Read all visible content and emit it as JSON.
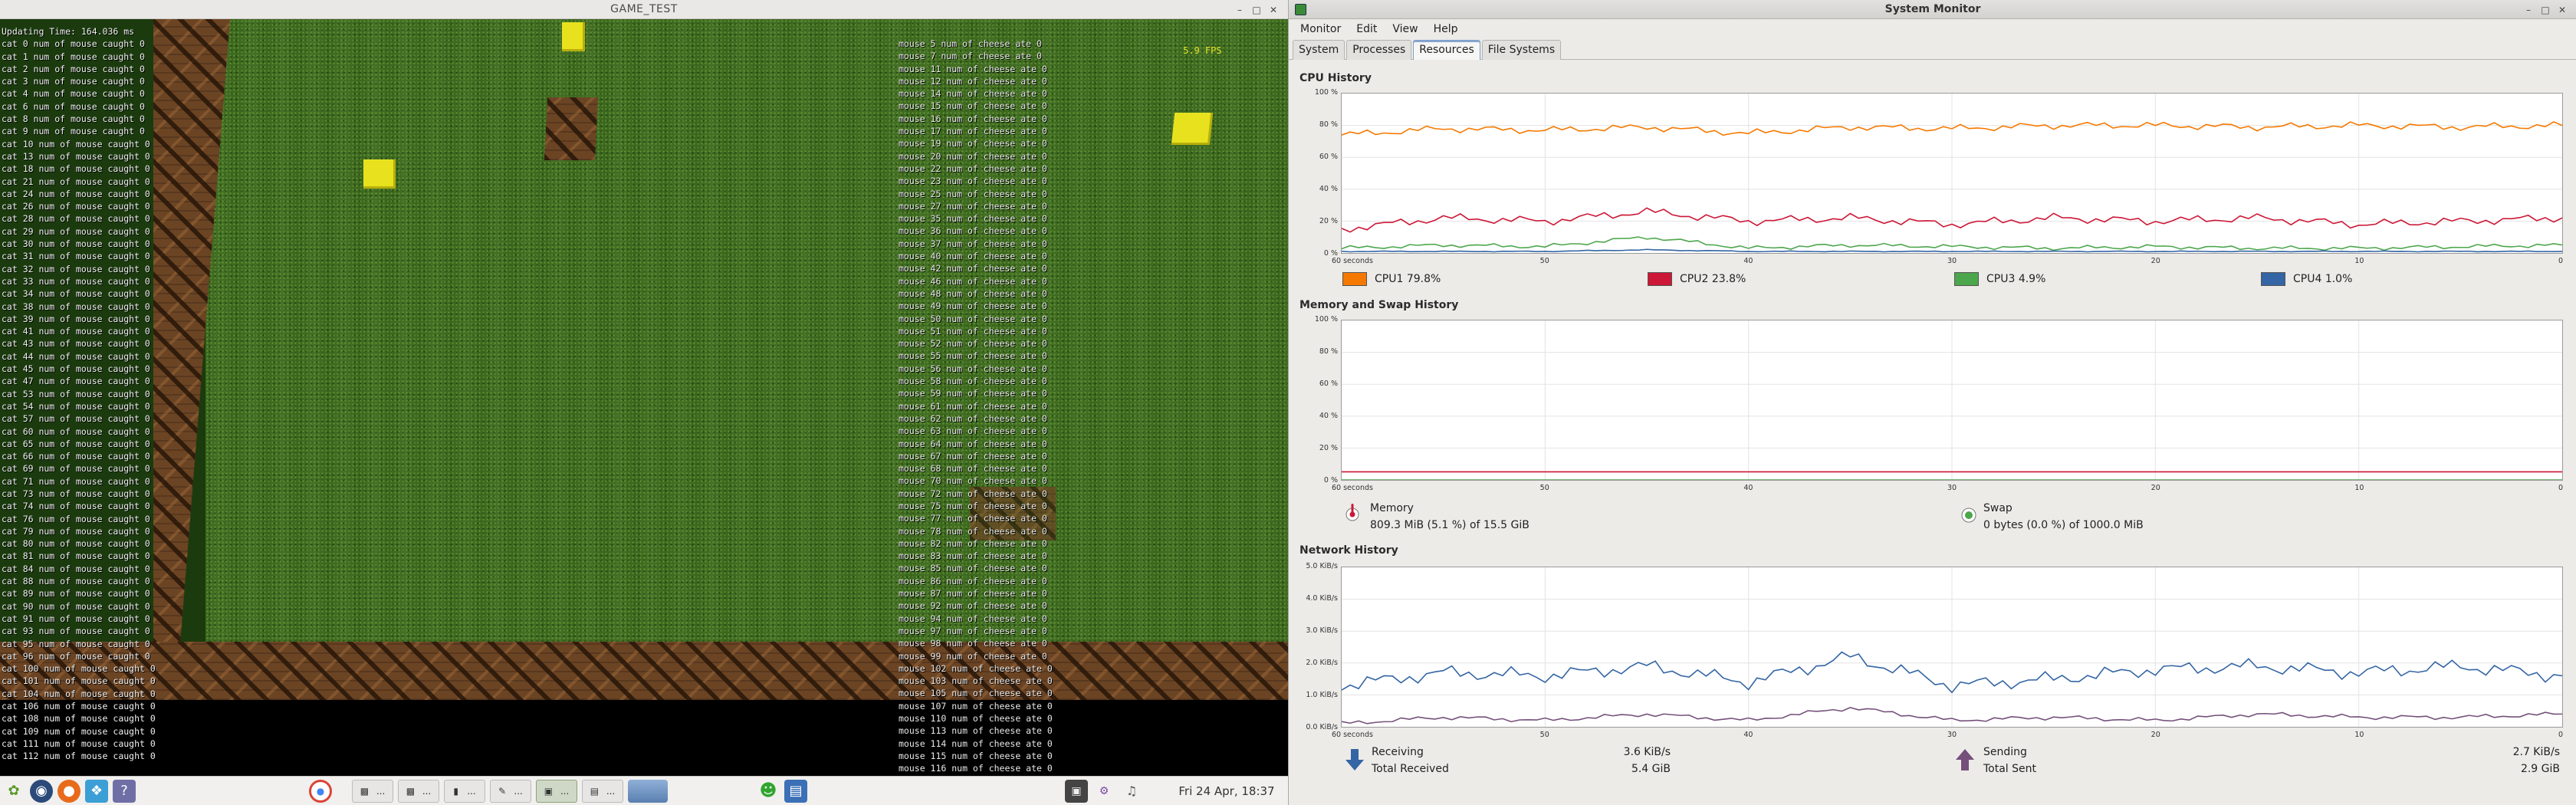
{
  "game": {
    "title": "GAME_TEST",
    "fps": "5.9 FPS",
    "cats": [
      "Updating Time: 164.036 ms",
      "cat 0 num of mouse caught 0",
      "cat 1 num of mouse caught 0",
      "cat 2 num of mouse caught 0",
      "cat 3 num of mouse caught 0",
      "cat 4 num of mouse caught 0",
      "cat 6 num of mouse caught 0",
      "cat 8 num of mouse caught 0",
      "cat 9 num of mouse caught 0",
      "cat 10 num of mouse caught 0",
      "cat 13 num of mouse caught 0",
      "cat 18 num of mouse caught 0",
      "cat 21 num of mouse caught 0",
      "cat 24 num of mouse caught 0",
      "cat 26 num of mouse caught 0",
      "cat 28 num of mouse caught 0",
      "cat 29 num of mouse caught 0",
      "cat 30 num of mouse caught 0",
      "cat 31 num of mouse caught 0",
      "cat 32 num of mouse caught 0",
      "cat 33 num of mouse caught 0",
      "cat 34 num of mouse caught 0",
      "cat 38 num of mouse caught 0",
      "cat 39 num of mouse caught 0",
      "cat 41 num of mouse caught 0",
      "cat 43 num of mouse caught 0",
      "cat 44 num of mouse caught 0",
      "cat 45 num of mouse caught 0",
      "cat 47 num of mouse caught 0",
      "cat 53 num of mouse caught 0",
      "cat 54 num of mouse caught 0",
      "cat 57 num of mouse caught 0",
      "cat 60 num of mouse caught 0",
      "cat 65 num of mouse caught 0",
      "cat 66 num of mouse caught 0",
      "cat 69 num of mouse caught 0",
      "cat 71 num of mouse caught 0",
      "cat 73 num of mouse caught 0",
      "cat 74 num of mouse caught 0",
      "cat 76 num of mouse caught 0",
      "cat 79 num of mouse caught 0",
      "cat 80 num of mouse caught 0",
      "cat 81 num of mouse caught 0",
      "cat 84 num of mouse caught 0",
      "cat 88 num of mouse caught 0",
      "cat 89 num of mouse caught 0",
      "cat 90 num of mouse caught 0",
      "cat 91 num of mouse caught 0",
      "cat 93 num of mouse caught 0",
      "cat 95 num of mouse caught 0",
      "cat 96 num of mouse caught 0",
      "cat 100 num of mouse caught 0",
      "cat 101 num of mouse caught 0",
      "cat 104 num of mouse caught 0",
      "cat 106 num of mouse caught 0",
      "cat 108 num of mouse caught 0",
      "cat 109 num of mouse caught 0",
      "cat 111 num of mouse caught 0",
      "cat 112 num of mouse caught 0"
    ],
    "mice": [
      "mouse 5 num of cheese ate 0",
      "mouse 7 num of cheese ate 0",
      "mouse 11 num of cheese ate 0",
      "mouse 12 num of cheese ate 0",
      "mouse 14 num of cheese ate 0",
      "mouse 15 num of cheese ate 0",
      "mouse 16 num of cheese ate 0",
      "mouse 17 num of cheese ate 0",
      "mouse 19 num of cheese ate 0",
      "mouse 20 num of cheese ate 0",
      "mouse 22 num of cheese ate 0",
      "mouse 23 num of cheese ate 0",
      "mouse 25 num of cheese ate 0",
      "mouse 27 num of cheese ate 0",
      "mouse 35 num of cheese ate 0",
      "mouse 36 num of cheese ate 0",
      "mouse 37 num of cheese ate 0",
      "mouse 40 num of cheese ate 0",
      "mouse 42 num of cheese ate 0",
      "mouse 46 num of cheese ate 0",
      "mouse 48 num of cheese ate 0",
      "mouse 49 num of cheese ate 0",
      "mouse 50 num of cheese ate 0",
      "mouse 51 num of cheese ate 0",
      "mouse 52 num of cheese ate 0",
      "mouse 55 num of cheese ate 0",
      "mouse 56 num of cheese ate 0",
      "mouse 58 num of cheese ate 0",
      "mouse 59 num of cheese ate 0",
      "mouse 61 num of cheese ate 0",
      "mouse 62 num of cheese ate 0",
      "mouse 63 num of cheese ate 0",
      "mouse 64 num of cheese ate 0",
      "mouse 67 num of cheese ate 0",
      "mouse 68 num of cheese ate 0",
      "mouse 70 num of cheese ate 0",
      "mouse 72 num of cheese ate 0",
      "mouse 75 num of cheese ate 0",
      "mouse 77 num of cheese ate 0",
      "mouse 78 num of cheese ate 0",
      "mouse 82 num of cheese ate 0",
      "mouse 83 num of cheese ate 0",
      "mouse 85 num of cheese ate 0",
      "mouse 86 num of cheese ate 0",
      "mouse 87 num of cheese ate 0",
      "mouse 92 num of cheese ate 0",
      "mouse 94 num of cheese ate 0",
      "mouse 97 num of cheese ate 0",
      "mouse 98 num of cheese ate 0",
      "mouse 99 num of cheese ate 0",
      "mouse 102 num of cheese ate 0",
      "mouse 103 num of cheese ate 0",
      "mouse 105 num of cheese ate 0",
      "mouse 107 num of cheese ate 0",
      "mouse 110 num of cheese ate 0",
      "mouse 113 num of cheese ate 0",
      "mouse 114 num of cheese ate 0",
      "mouse 115 num of cheese ate 0",
      "mouse 116 num of cheese ate 0"
    ]
  },
  "taskbar": {
    "clock": "Fri 24 Apr, 18:37",
    "task_label": "..."
  },
  "sysmon": {
    "title": "System Monitor",
    "menu": [
      "Monitor",
      "Edit",
      "View",
      "Help"
    ],
    "tabs": [
      "System",
      "Processes",
      "Resources",
      "File Systems"
    ],
    "active_tab": "Resources",
    "cpu": {
      "title": "CPU History",
      "yticks": [
        "100 %",
        "80 %",
        "60 %",
        "40 %",
        "20 %",
        "0 %"
      ],
      "legend": [
        {
          "label": "CPU1  79.8%",
          "color": "#f57900"
        },
        {
          "label": "CPU2  23.8%",
          "color": "#cc1736"
        },
        {
          "label": "CPU3  4.9%",
          "color": "#4ca64c"
        },
        {
          "label": "CPU4  1.0%",
          "color": "#3465a4"
        }
      ]
    },
    "mem": {
      "title": "Memory and Swap History",
      "yticks": [
        "100 %",
        "80 %",
        "60 %",
        "40 %",
        "20 %",
        "0 %"
      ],
      "memory_label": "Memory",
      "memory_value": "809.3 MiB (5.1 %) of 15.5 GiB",
      "swap_label": "Swap",
      "swap_value": "0 bytes (0.0 %) of 1000.0 MiB",
      "memory_color": "#cc1736",
      "swap_color": "#4ca64c"
    },
    "net": {
      "title": "Network History",
      "yticks": [
        "5.0 KiB/s",
        "4.0 KiB/s",
        "3.0 KiB/s",
        "2.0 KiB/s",
        "1.0 KiB/s",
        "0.0 KiB/s"
      ],
      "receiving_label": "Receiving",
      "receiving_value": "3.6 KiB/s",
      "total_received_label": "Total Received",
      "total_received_value": "5.4 GiB",
      "sending_label": "Sending",
      "sending_value": "2.7 KiB/s",
      "total_sent_label": "Total Sent",
      "total_sent_value": "2.9 GiB",
      "receive_color": "#3465a4",
      "send_color": "#75507b"
    },
    "xticks": [
      "60 seconds",
      "50",
      "40",
      "30",
      "20",
      "10",
      "0"
    ]
  },
  "chart_data": [
    {
      "type": "line",
      "title": "CPU History",
      "x": [
        60,
        55,
        50,
        45,
        40,
        35,
        30,
        25,
        20,
        15,
        10,
        5,
        0
      ],
      "ylim": [
        0,
        100
      ],
      "grid": true,
      "series": [
        {
          "name": "CPU1",
          "values": [
            74,
            78,
            77,
            79,
            75,
            79,
            78,
            80,
            80,
            79,
            80,
            79,
            80
          ]
        },
        {
          "name": "CPU2",
          "values": [
            15,
            22,
            20,
            26,
            20,
            22,
            18,
            22,
            20,
            22,
            18,
            20,
            22
          ]
        },
        {
          "name": "CPU3",
          "values": [
            3,
            5,
            4,
            10,
            3,
            5,
            4,
            3,
            4,
            3,
            3,
            4,
            5
          ]
        },
        {
          "name": "CPU4",
          "values": [
            1,
            1,
            1,
            2,
            1,
            1,
            1,
            1,
            1,
            1,
            1,
            1,
            1
          ]
        }
      ]
    },
    {
      "type": "line",
      "title": "Memory and Swap History",
      "x": [
        60,
        0
      ],
      "ylim": [
        0,
        100
      ],
      "grid": true,
      "series": [
        {
          "name": "Memory",
          "values": [
            5.1,
            5.1
          ]
        },
        {
          "name": "Swap",
          "values": [
            0,
            0
          ]
        }
      ]
    },
    {
      "type": "line",
      "title": "Network History",
      "x": [
        60,
        55,
        50,
        45,
        40,
        35,
        30,
        25,
        20,
        15,
        10,
        5,
        0
      ],
      "ylim": [
        0,
        5
      ],
      "grid": true,
      "series": [
        {
          "name": "Receiving",
          "values": [
            1.3,
            1.7,
            1.6,
            1.9,
            1.4,
            2.2,
            1.3,
            1.5,
            1.8,
            1.9,
            1.7,
            1.9,
            1.6
          ]
        },
        {
          "name": "Sending",
          "values": [
            0.1,
            0.3,
            0.2,
            0.4,
            0.2,
            0.6,
            0.2,
            0.3,
            0.2,
            0.4,
            0.3,
            0.3,
            0.4
          ]
        }
      ]
    }
  ]
}
